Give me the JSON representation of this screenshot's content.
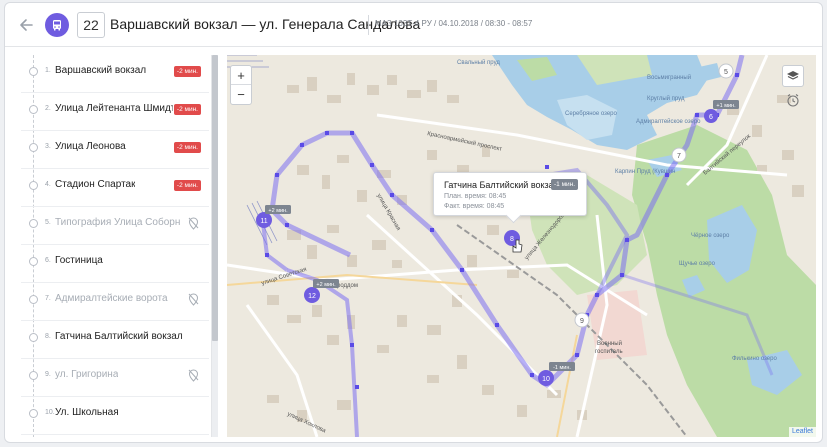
{
  "header": {
    "route_number": "22",
    "title": "Варшавский вокзал — ул. Генерала Сандалова",
    "meta": "МАЗ 103Т-4 РУ / 04.10.2018 / 08:30 - 08:57"
  },
  "stops": [
    {
      "num": "1.",
      "name": "Варшавский вокзал",
      "badge": "-2 мин.",
      "skipped": false
    },
    {
      "num": "2.",
      "name": "Улица Лейтенанта Шмидта",
      "badge": "-2 мин.",
      "skipped": false
    },
    {
      "num": "3.",
      "name": "Улица Леонова",
      "badge": "-2 мин.",
      "skipped": false
    },
    {
      "num": "4.",
      "name": "Стадион Спартак",
      "badge": "-2 мин.",
      "skipped": false
    },
    {
      "num": "5.",
      "name": "Типография Улица Соборная",
      "badge": "",
      "skipped": true
    },
    {
      "num": "6.",
      "name": "Гостиница",
      "badge": "",
      "skipped": false
    },
    {
      "num": "7.",
      "name": "Адмиралтейские ворота",
      "badge": "",
      "skipped": true
    },
    {
      "num": "8.",
      "name": "Гатчина Балтийский вокзал",
      "badge": "",
      "skipped": false
    },
    {
      "num": "9.",
      "name": "ул. Григорина",
      "badge": "",
      "skipped": true
    },
    {
      "num": "10.",
      "name": "Ул. Школьная",
      "badge": "",
      "skipped": false
    }
  ],
  "map": {
    "zoom_in": "+",
    "zoom_out": "−",
    "attribution": "Leaflet",
    "labels": {
      "lake_svalny": "Свальный пруд",
      "lake_serebryanoe": "Серебряное озеро",
      "lake_admiralteyskoe": "Адмиралтейское озеро",
      "lake_karpin": "Карпин Пруд (Кувшин",
      "lake_chernoe": "Чёрное озеро",
      "lake_shchuchie": "Щучье озеро",
      "lake_filkino": "Филькино озеро",
      "pond_krugly": "Круглый пруд",
      "lake_vosmigranny": "Восьмигранный",
      "prospect": "Красноармейский проспект",
      "per_baltiyskiy": "Балтийский переулок",
      "voenny": "Военный",
      "hospital": "госпиталь",
      "ul_krasnaya": "улица Красная",
      "ul_zhelezn": "улица Железнодорожная",
      "ul_sov": "улица Советская",
      "roddom": "роддом",
      "ul_hokhlova": "улица Хохлова"
    },
    "markers": [
      {
        "label": "5"
      },
      {
        "label": "6",
        "badge": "+1 мин."
      },
      {
        "label": "7"
      },
      {
        "label": "8"
      },
      {
        "label": "9"
      },
      {
        "label": "10",
        "badge": "-1 мин."
      },
      {
        "label": "11",
        "badge": "+2 мин."
      },
      {
        "label": "12",
        "badge": "+2 мин."
      }
    ],
    "tooltip": {
      "name": "Гатчина Балтийский вокзал",
      "badge": "-1 мин.",
      "planned": "План. время: 08:45",
      "actual": "Факт. время: 08:45"
    }
  },
  "colors": {
    "accent": "#6f5ce0",
    "route": "#7b6ff0",
    "badge_late": "#e14b4b",
    "badge_neutral": "#7d8590",
    "water": "#a8cee8",
    "park": "#cfe3b9",
    "forest": "#bcdca6",
    "land": "#ede9df"
  }
}
